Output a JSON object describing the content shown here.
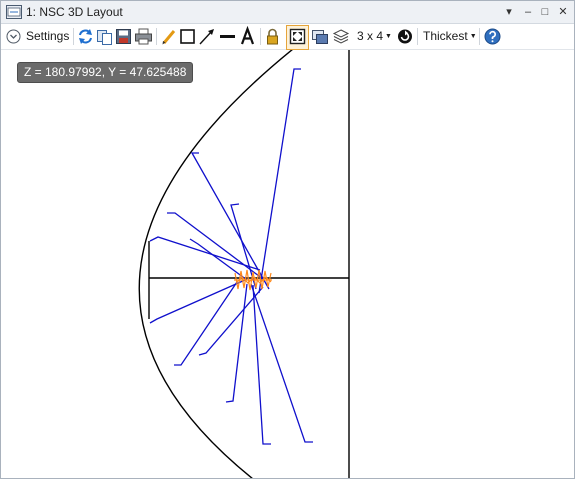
{
  "window": {
    "title": "1: NSC 3D Layout",
    "controls": {
      "menu": "▾",
      "minimize": "–",
      "maximize": "□",
      "close": "✕"
    }
  },
  "toolbar": {
    "settings_label": "Settings",
    "grid_label": "3 x 4",
    "line_thickness_label": "Thickest",
    "icons": [
      "settings-toggle-icon",
      "refresh-icon",
      "copy-icon",
      "save-icon",
      "print-icon",
      "pencil-icon",
      "rectangle-icon",
      "arrow-icon",
      "line-icon",
      "text-icon",
      "lock-icon",
      "fit-window-icon",
      "layer-window-icon",
      "stack-layers-icon",
      "rotate-icon",
      "help-icon"
    ]
  },
  "viewport": {
    "coordinate_readout": "Z = 180.97992, Y = 47.625488"
  },
  "colors": {
    "rays": "#1010cc",
    "source": "#ff8a1c",
    "geometry": "#000000",
    "accent": "#2f6fbf"
  }
}
